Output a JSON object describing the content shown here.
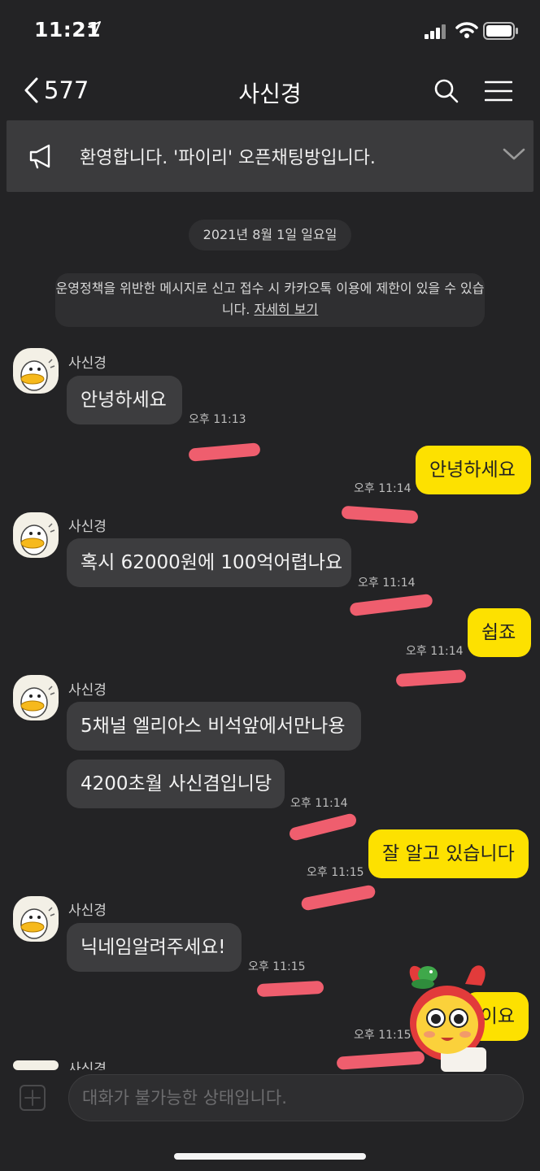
{
  "status": {
    "time": "11:21"
  },
  "nav": {
    "back_count": "577",
    "title": "사신경"
  },
  "notice": {
    "text": "환영합니다. '파이리' 오픈채팅방입니다."
  },
  "date_divider": "2021년 8월 1일 일요일",
  "policy": {
    "text": "운영정책을 위반한 메시지로 신고 접수 시 카카오톡 이용에 제한이 있을 수 있습니다.",
    "link": "자세히 보기"
  },
  "messages": [
    {
      "sender": "사신경",
      "text": "안녕하세요",
      "time": "오후 11:13"
    },
    {
      "text": "안녕하세요",
      "time": "오후 11:14"
    },
    {
      "sender": "사신경",
      "text": "혹시 62000원에 100억어렵나요",
      "time": "오후 11:14"
    },
    {
      "text": "쉽죠",
      "time": "오후 11:14"
    },
    {
      "sender": "사신경",
      "text": "5채널 엘리아스 비석앞에서만나용"
    },
    {
      "text": "4200초월 사신겸입니당",
      "time": "오후 11:14"
    },
    {
      "text": "잘 알고 있습니다",
      "time": "오후 11:15"
    },
    {
      "sender": "사신경",
      "text": "닉네임알려주세요!",
      "time": "오후 11:15"
    },
    {
      "text": "이요",
      "time": "오후 11:15"
    },
    {
      "sender": "사신경"
    }
  ],
  "input": {
    "placeholder": "대화가 불가능한 상태입니다."
  },
  "colors": {
    "background": "#232325",
    "bubble_in": "#3d3d3f",
    "bubble_out": "#fde100",
    "redaction": "#ef5e6e"
  }
}
